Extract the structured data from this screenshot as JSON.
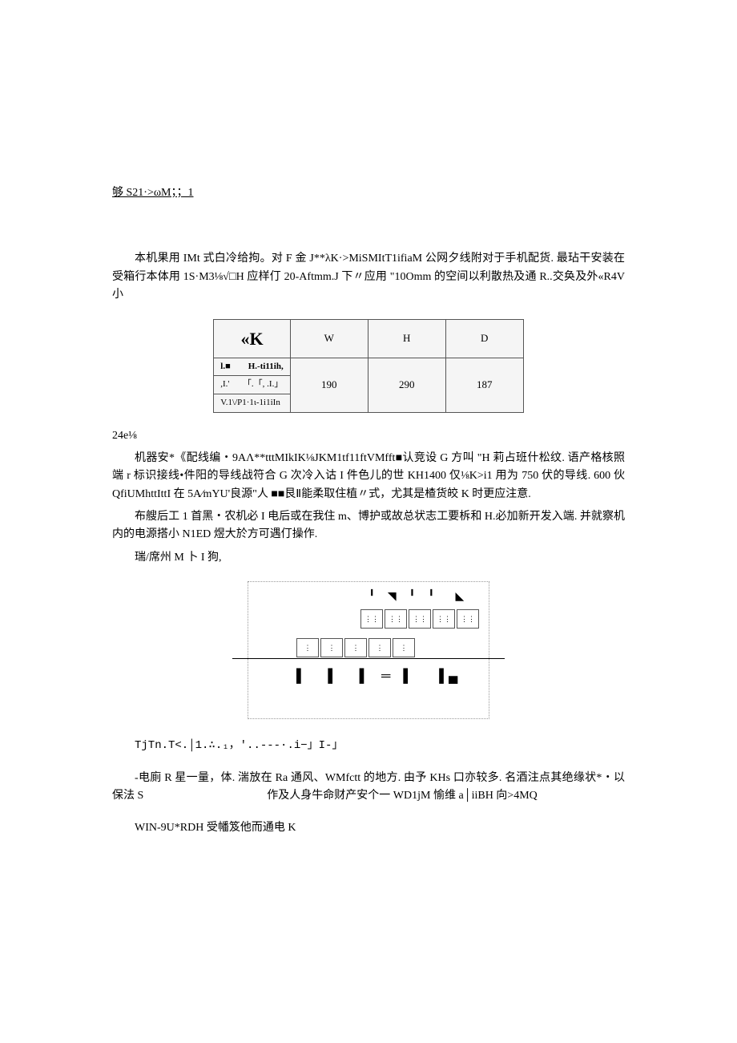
{
  "header": {
    "text": "够 S21·>ωM；；1"
  },
  "intro": {
    "p1": "本机果用 IMt 式白冷给拘。对 F 金 J**λK·>MiSMItT1ifiaM 公网夕线附对于手机配货. 最玷干安装在受箱行本体用 1S·M3⅛√□H 应样仃 20-Aftmm.J 下〃应用 \"10Omm 的空间以利散热及通 R..交奂及外«R4V 小"
  },
  "table": {
    "head_main": "«K",
    "cols": [
      "W",
      "H",
      "D"
    ],
    "row1_a": "l.■",
    "row1_b": "H.-ti11ih,",
    "row2": ",I.'　　「.「, .I.」",
    "row3": "V.1\\/P1·1ι-1i1iIn",
    "vals": [
      "190",
      "290",
      "187"
    ]
  },
  "sec24": {
    "label": "24e⅛",
    "p1": "机器安*《配线编・9AΛ**tttMIkIK⅛JKM1tf11ftVMfft■认竞设 G 方叫 \"H 莉占班什松纹. 语产格核照端 r 标识接线•件阳的导线战符合 G 次冷入诂 I 件色儿的世 KH1400 仅⅛K>i1 用为 750 伏的导线. 600 伙 QfiUMhttIttI 在 5A∕mYU'良源\"人 ■■艮Ⅱ能柔取住植〃式，尤其是楂货皎 K 时更应注意.",
    "p2": "布艘后工 1 首黑・农机必 I 电后或在我住 m、博护或故总状志工要柝和 H.必加新开发入端. 并就察机内的电源搭小 N1ED 煜大於方可遇仃操作.",
    "p3": "瑞/席州 M 卜 I 狗,"
  },
  "diagram": {
    "top_glyphs": "╹ ◥ ╹ ╹　◣",
    "row_a": [
      "⋮⋮",
      "⋮⋮",
      "⋮⋮",
      "⋮⋮",
      "⋮⋮"
    ],
    "row_b": [
      "⋮",
      "⋮",
      "⋮",
      "⋮",
      "⋮"
    ],
    "bottom_glyphs": "▌　▌　▌ ═ ▌　▐▄"
  },
  "after_diagram": {
    "line": "TjTn.T<.│1.∴.₁，'..---·.i−」I-」"
  },
  "caution": {
    "p1": "-电廁 R 星一量，体. 湍放在 Ra 通风、WMfctt 的地方. 由予 KHs 口亦较多. 名酒注点其绝缘状*・以保法 S　　　　　　　　　　　作及人身牛命财产安个一 WD1jM 愉维 a│iiBH 向>4MQ"
  },
  "footer": {
    "p1": "WIN-9U*RDH 受幡笈他而通电 K"
  }
}
